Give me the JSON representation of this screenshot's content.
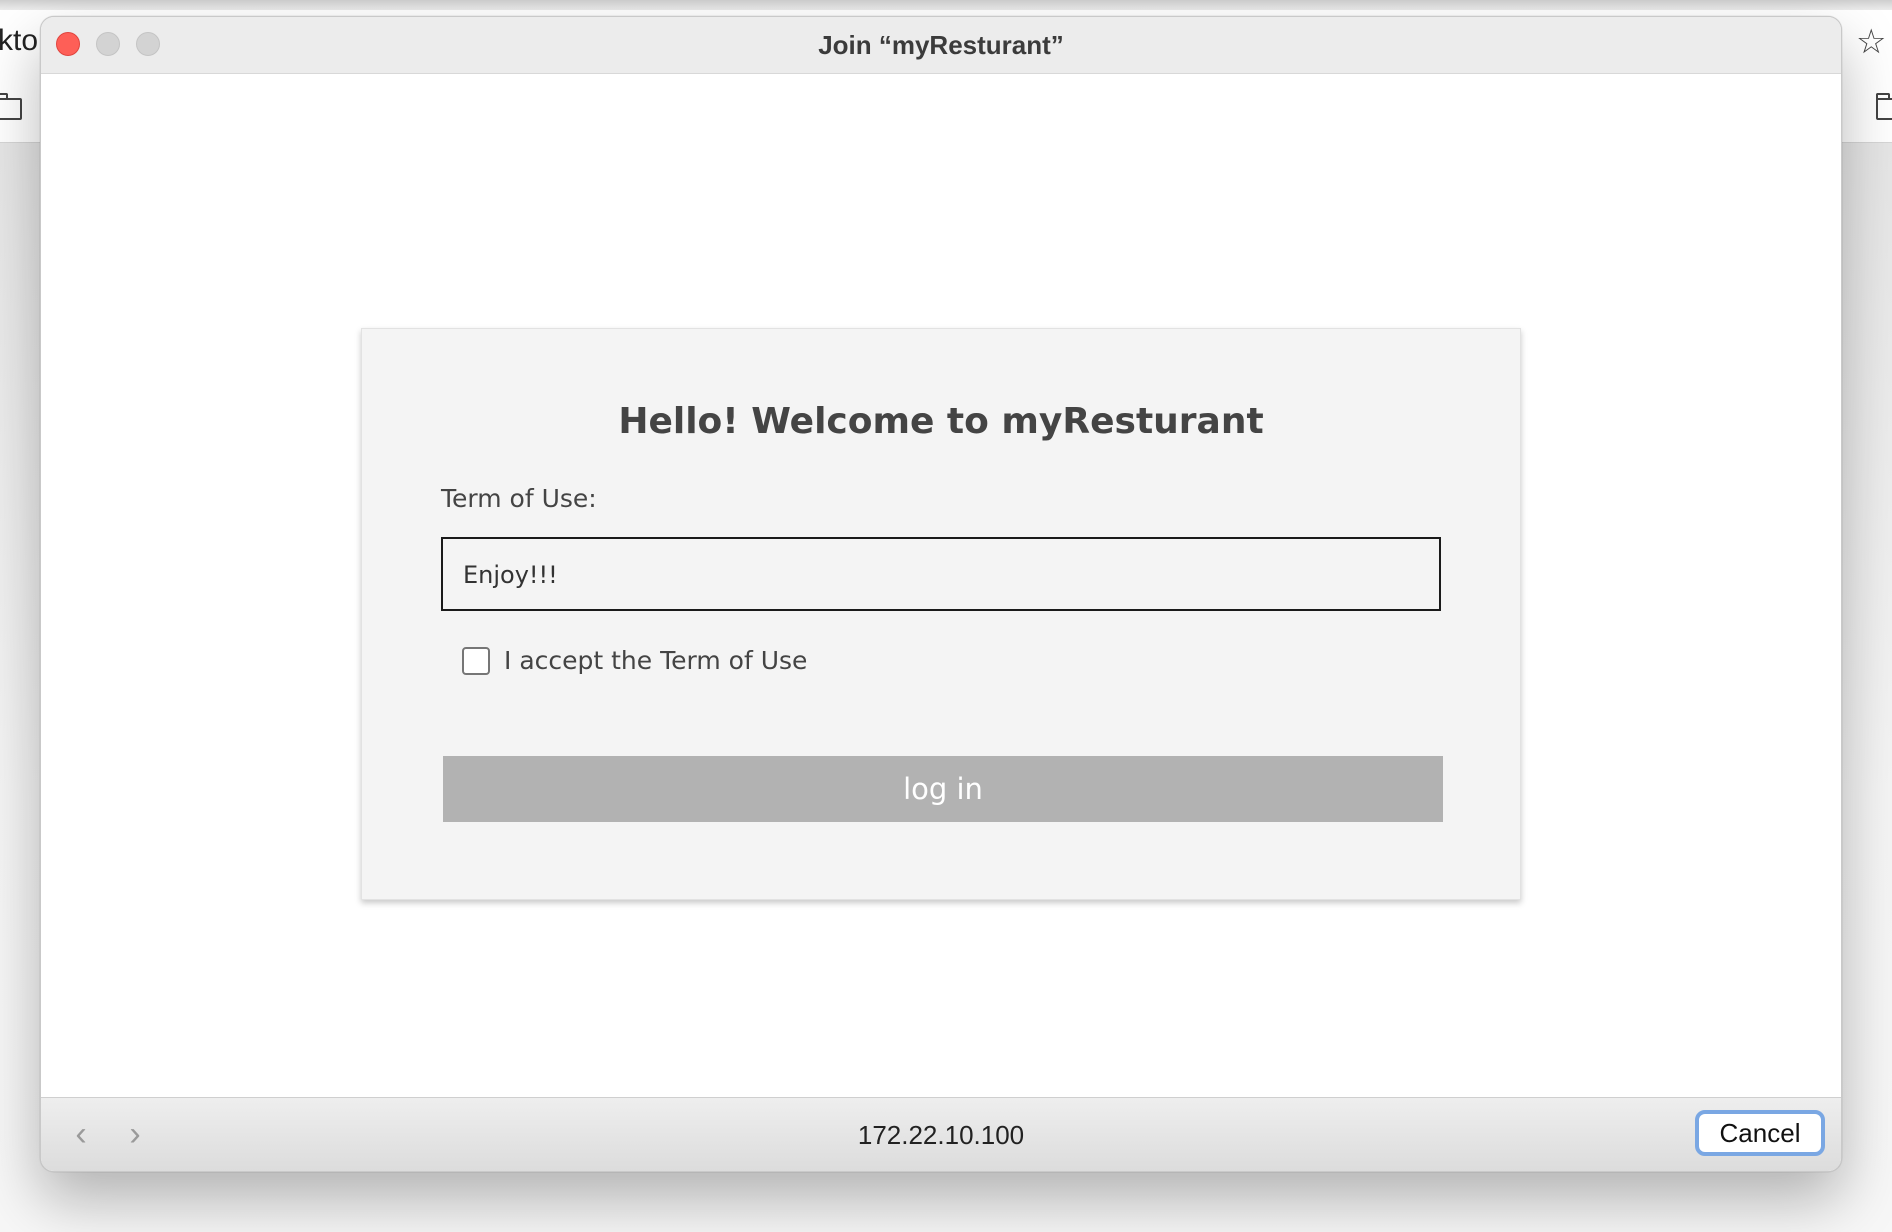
{
  "background_browser": {
    "tab_fragment": "ktop",
    "star_icon": "star-icon",
    "folder_icon": "folder-icon"
  },
  "window": {
    "title": "Join “myResturant”",
    "traffic_lights": {
      "close_color": "#fe5f57",
      "inactive_color": "#d3d3d3"
    }
  },
  "portal": {
    "heading": "Hello! Welcome to myResturant",
    "terms_label": "Term of Use:",
    "terms_text": "Enjoy!!!",
    "accept_label": "I accept the Term of Use",
    "accept_checked": false,
    "login_label": "log in",
    "login_color": "#b2b2b2"
  },
  "bottombar": {
    "back_icon": "chevron-left-icon",
    "forward_icon": "chevron-right-icon",
    "address": "172.22.10.100",
    "cancel_label": "Cancel",
    "cancel_focus_color": "#7aa7e3"
  }
}
